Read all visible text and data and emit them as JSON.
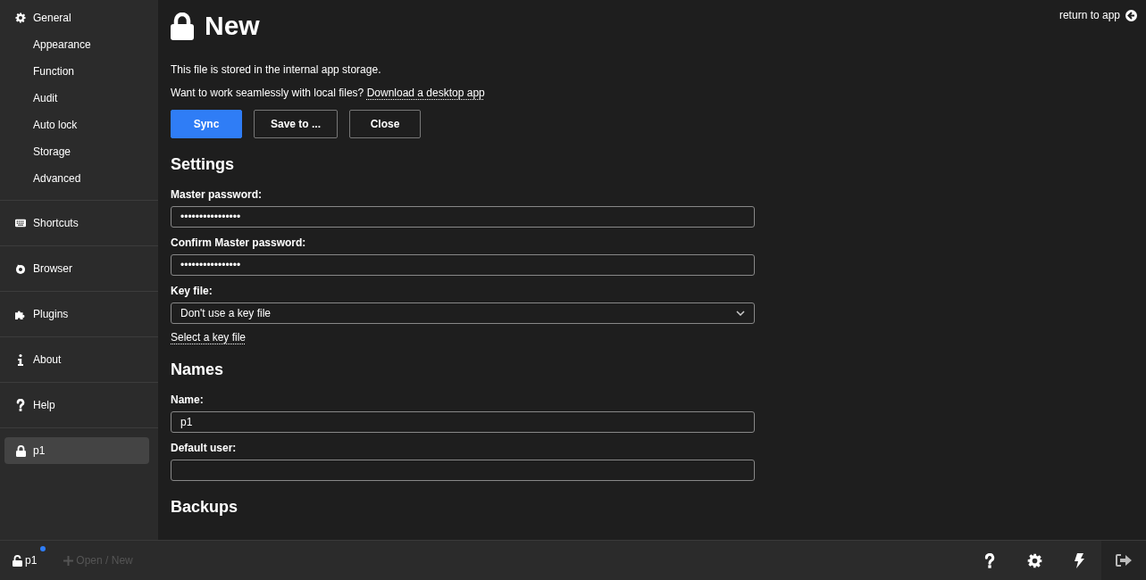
{
  "sidebar": {
    "sections": [
      {
        "label": "General",
        "selected": false,
        "children": [
          {
            "label": "Appearance",
            "selected": false
          },
          {
            "label": "Function",
            "selected": false
          },
          {
            "label": "Audit",
            "selected": false
          },
          {
            "label": "Auto lock",
            "selected": false
          },
          {
            "label": "Storage",
            "selected": false
          },
          {
            "label": "Advanced",
            "selected": false
          }
        ]
      },
      {
        "label": "Shortcuts",
        "selected": false
      },
      {
        "label": "Browser",
        "selected": false
      },
      {
        "label": "Plugins",
        "selected": false
      },
      {
        "label": "About",
        "selected": false
      },
      {
        "label": "Help",
        "selected": false
      },
      {
        "label": "p1",
        "selected": true
      }
    ]
  },
  "main": {
    "return_link": "return to app",
    "title": "New",
    "notes": [
      {
        "text": "This file is stored in the internal app storage."
      },
      {
        "text": "Want to work seamlessly with local files?",
        "link": "Download a desktop app"
      }
    ],
    "buttons": [
      {
        "label": "Sync",
        "primary": true
      },
      {
        "label": "Save to ...",
        "primary": false
      },
      {
        "label": "Close",
        "primary": false
      }
    ],
    "sections": [
      {
        "title": "Settings",
        "fields": [
          {
            "kind": "input",
            "label": "Master password:",
            "value": "••••••••••••••••"
          },
          {
            "kind": "input",
            "label": "Confirm Master password:",
            "value": "••••••••••••••••"
          },
          {
            "kind": "select",
            "label": "Key file:",
            "value": "Don't use a key file",
            "link": "Select a key file"
          }
        ]
      },
      {
        "title": "Names",
        "fields": [
          {
            "kind": "input",
            "label": "Name:",
            "value": "p1"
          },
          {
            "kind": "input",
            "label": "Default user:"
          }
        ]
      },
      {
        "title": "Backups"
      }
    ]
  },
  "footer": {
    "file": {
      "name": "p1",
      "modified": true
    },
    "open_new": {
      "label": "Open / New",
      "disabled": true
    },
    "tools": [
      {
        "selected": false
      },
      {
        "selected": false
      },
      {
        "selected": false
      },
      {
        "selected": false
      }
    ]
  }
}
